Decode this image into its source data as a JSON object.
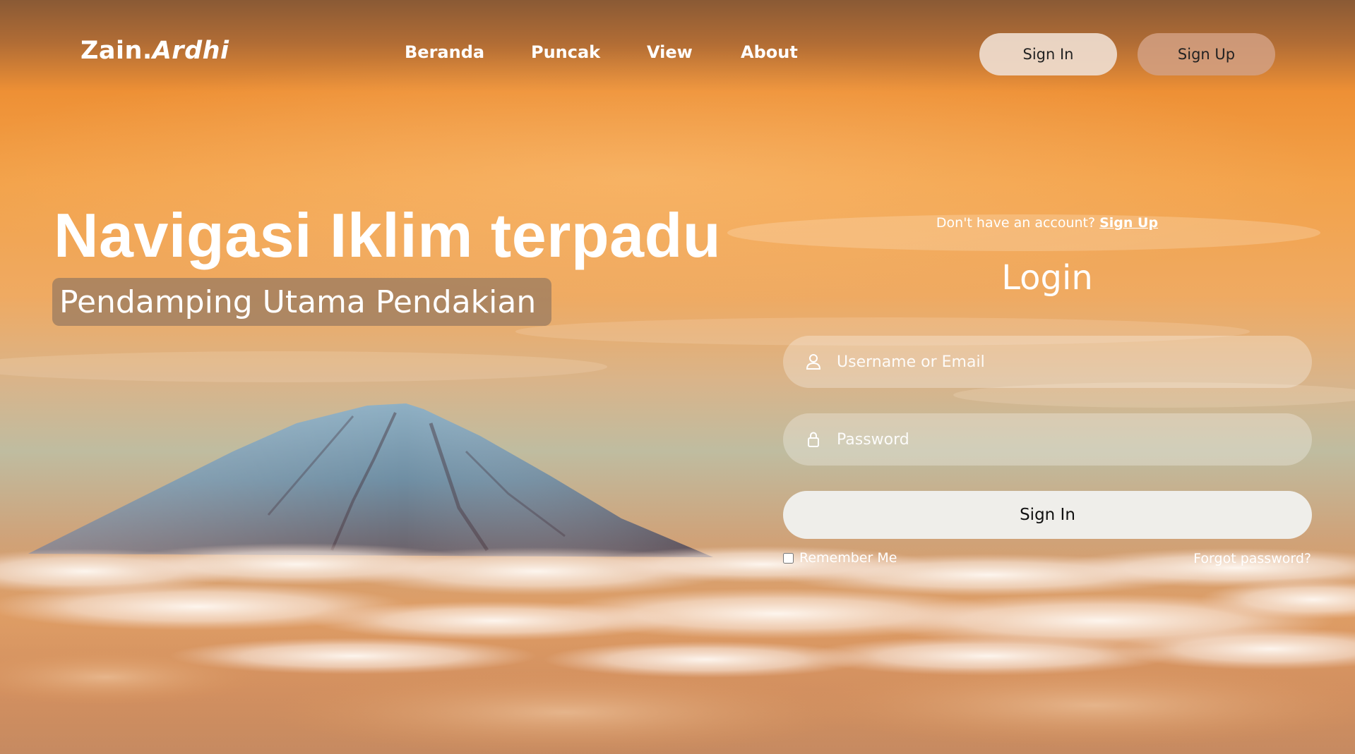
{
  "navbar": {
    "brand_prefix": "Zain.",
    "brand_suffix": "Ardhi",
    "links": [
      "Beranda",
      "Puncak",
      "View",
      "About"
    ],
    "sign_in_label": "Sign In",
    "sign_up_label": "Sign Up"
  },
  "hero": {
    "title": "Navigasi Iklim terpadu",
    "subtitle": "Pendamping Utama Pendakian"
  },
  "login": {
    "account_prompt": "Don't have an account?",
    "account_link": "Sign Up",
    "title": "Login",
    "username_placeholder": "Username or Email",
    "username_value": "",
    "password_placeholder": "Password",
    "password_value": "",
    "submit_label": "Sign In",
    "remember_label": "Remember Me",
    "remember_checked": false,
    "forgot_label": "Forgot password?"
  },
  "icons": {
    "username_icon": "user-icon",
    "password_icon": "lock-icon"
  },
  "colors": {
    "sky_orange": "#f3a24a",
    "navbar_top": "#8a5a35",
    "sign_in_pill": "#eedccd",
    "sign_up_pill": "#d2a082",
    "subtitle_badge": "#96785f",
    "submit_button": "#f0f0ee"
  }
}
